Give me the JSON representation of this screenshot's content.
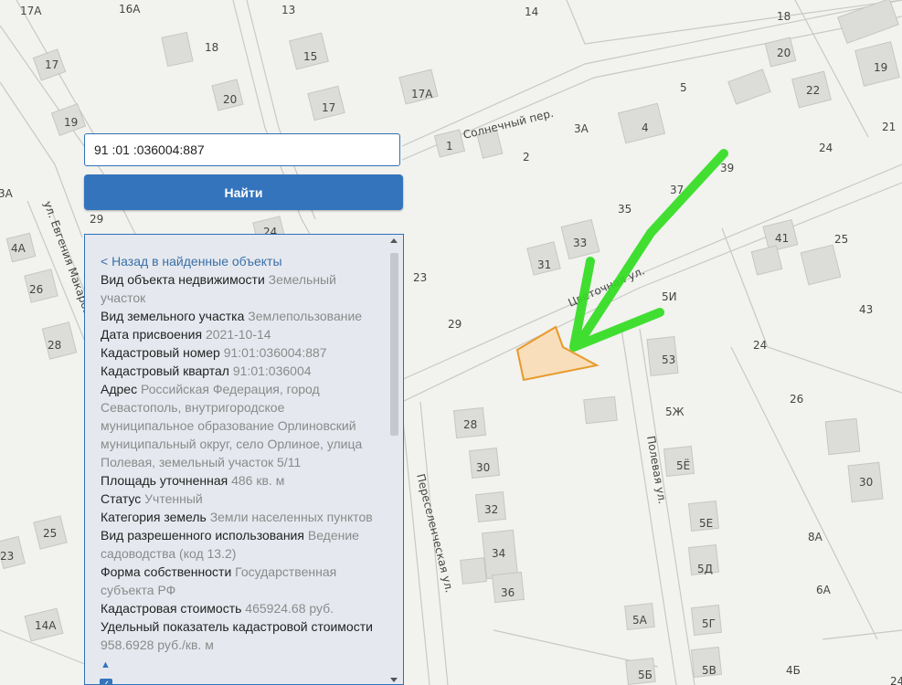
{
  "map": {
    "streets": {
      "solnechny": "Солнечный пер.",
      "evgeniya_makarova": "ул. Евгения Макарова",
      "tsvetochnaya": "Цветочная ул.",
      "polevaya": "Полевая ул.",
      "pereselencheskaya": "Переселенческая ул."
    },
    "house_numbers": [
      "17А",
      "16А",
      "13",
      "14",
      "18",
      "20",
      "22",
      "19",
      "21",
      "17",
      "18",
      "15",
      "5",
      "20",
      "17",
      "17А",
      "19",
      "4",
      "3А",
      "24",
      "1",
      "2",
      "39",
      "37",
      "35",
      "24",
      "41",
      "25",
      "43",
      "33",
      "31",
      "5И",
      "23",
      "29",
      "53",
      "24",
      "26",
      "28",
      "28",
      "5Ж",
      "30",
      "5Ё",
      "30",
      "32",
      "5Е",
      "8А",
      "34",
      "5Д",
      "6А",
      "36",
      "25",
      "23",
      "14А",
      "5А",
      "5Г",
      "5Б",
      "5В",
      "4Б",
      "26",
      "28",
      "3А",
      "4А",
      "24",
      "24"
    ],
    "parcel_color": "#f5a623",
    "arrow_color": "#22dd22"
  },
  "search": {
    "value": "91 :01 :036004:887",
    "button_label": "Найти"
  },
  "panel": {
    "back_link": "< Назад в найденные объекты",
    "rows": [
      {
        "label": "Вид объекта недвижимости",
        "value": "Земельный участок"
      },
      {
        "label": "Вид земельного участка",
        "value": "Землепользование"
      },
      {
        "label": "Дата присвоения",
        "value": "2021-10-14"
      },
      {
        "label": "Кадастровый номер",
        "value": "91:01:036004:887"
      },
      {
        "label": "Кадастровый квартал",
        "value": "91:01:036004"
      },
      {
        "label": "Адрес",
        "value": "Российская Федерация, город Севастополь, внутригородское муниципальное образование Орлиновский муниципальный округ, село Орлиное, улица Полевая, земельный участок 5/11"
      },
      {
        "label": "Площадь уточненная",
        "value": "486 кв. м"
      },
      {
        "label": "Статус",
        "value": "Учтенный"
      },
      {
        "label": "Категория земель",
        "value": "Земли населенных пунктов"
      },
      {
        "label": "Вид разрешенного использования",
        "value": "Ведение садоводства (код 13.2)"
      },
      {
        "label": "Форма собственности",
        "value": "Государственная субъекта РФ"
      },
      {
        "label": "Кадастровая стоимость",
        "value": "465924.68 руб."
      },
      {
        "label": "Удельный показатель кадастровой стоимости",
        "value": "958.6928 руб./кв. м"
      }
    ],
    "expand_icon": "triangle-up-icon"
  }
}
